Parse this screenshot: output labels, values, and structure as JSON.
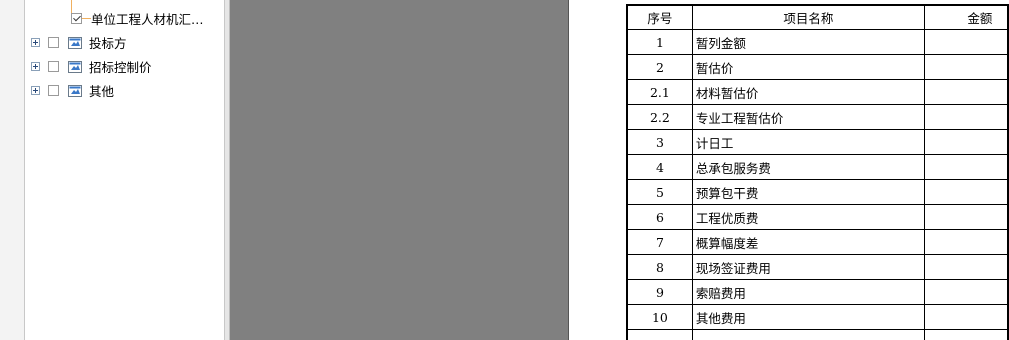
{
  "tree": {
    "items": [
      {
        "label": "单位工程人材机汇…",
        "checked": true,
        "expander": false,
        "icon": "none"
      },
      {
        "label": "投标方",
        "checked": false,
        "expander": true,
        "icon": "folder-icon"
      },
      {
        "label": "招标控制价",
        "checked": false,
        "expander": true,
        "icon": "folder-icon"
      },
      {
        "label": "其他",
        "checked": false,
        "expander": true,
        "icon": "folder-icon"
      }
    ]
  },
  "table": {
    "headers": [
      "序号",
      "项目名称",
      "金额"
    ],
    "rows": [
      {
        "no": "1",
        "name": "暂列金额"
      },
      {
        "no": "2",
        "name": "暂估价"
      },
      {
        "no": "2.1",
        "name": "材料暂估价"
      },
      {
        "no": "2.2",
        "name": "专业工程暂估价"
      },
      {
        "no": "3",
        "name": "计日工"
      },
      {
        "no": "4",
        "name": "总承包服务费"
      },
      {
        "no": "5",
        "name": "预算包干费"
      },
      {
        "no": "6",
        "name": "工程优质费"
      },
      {
        "no": "7",
        "name": "概算幅度差"
      },
      {
        "no": "8",
        "name": "现场签证费用"
      },
      {
        "no": "9",
        "name": "索赔费用"
      },
      {
        "no": "10",
        "name": "其他费用"
      },
      {
        "no": "",
        "name": ""
      }
    ]
  },
  "colors": {
    "gray_area": "#808080",
    "connector": "#f0b060",
    "folder_blue": "#3a78c8"
  }
}
